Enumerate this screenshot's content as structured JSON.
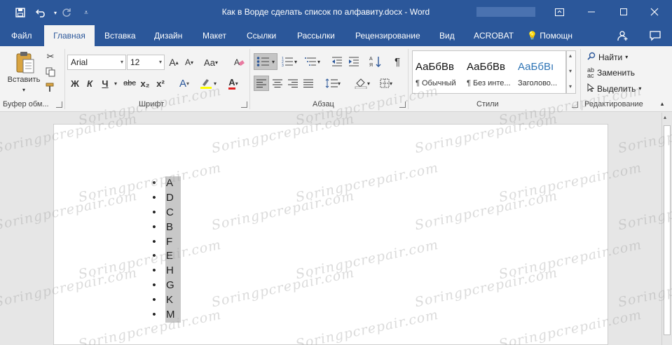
{
  "window": {
    "title": "Как в Ворде сделать список по алфавиту.docx - Word",
    "controls": [
      "minimize-icon",
      "maximize-icon",
      "close-icon",
      "ribbon-display-icon"
    ]
  },
  "qat": [
    "save-icon",
    "undo-icon",
    "redo-icon",
    "customize-icon"
  ],
  "tabs": [
    {
      "label": "Файл"
    },
    {
      "label": "Главная"
    },
    {
      "label": "Вставка"
    },
    {
      "label": "Дизайн"
    },
    {
      "label": "Макет"
    },
    {
      "label": "Ссылки"
    },
    {
      "label": "Рассылки"
    },
    {
      "label": "Рецензирование"
    },
    {
      "label": "Вид"
    },
    {
      "label": "ACROBAT"
    }
  ],
  "tell_me": "Помощн",
  "ribbon": {
    "clipboard": {
      "paste_label": "Вставить",
      "group_label": "Буфер обм..."
    },
    "font": {
      "name": "Arial",
      "size": "12",
      "group_label": "Шрифт",
      "bold": "Ж",
      "italic": "К",
      "underline": "Ч",
      "strike": "abc",
      "sub": "x₂",
      "sup": "x²",
      "case": "Aa",
      "grow": "A",
      "shrink": "A",
      "effects": "A",
      "color": "A"
    },
    "paragraph": {
      "group_label": "Абзац"
    },
    "styles": {
      "group_label": "Стили",
      "items": [
        {
          "sample": "АаБбВв",
          "name": "¶ Обычный"
        },
        {
          "sample": "АаБбВв",
          "name": "¶ Без инте..."
        },
        {
          "sample": "АаБбВı",
          "name": "Заголово..."
        }
      ]
    },
    "editing": {
      "find": "Найти",
      "replace": "Заменить",
      "select": "Выделить",
      "group_label": "Редактирование"
    }
  },
  "document": {
    "list_items": [
      "A",
      "D",
      "C",
      "B",
      "F",
      "E",
      "H",
      "G",
      "K",
      "M"
    ]
  },
  "watermark": "Soringpcrepair.com",
  "colors": {
    "accent": "#2b579a",
    "selection": "#c8c8c8"
  }
}
